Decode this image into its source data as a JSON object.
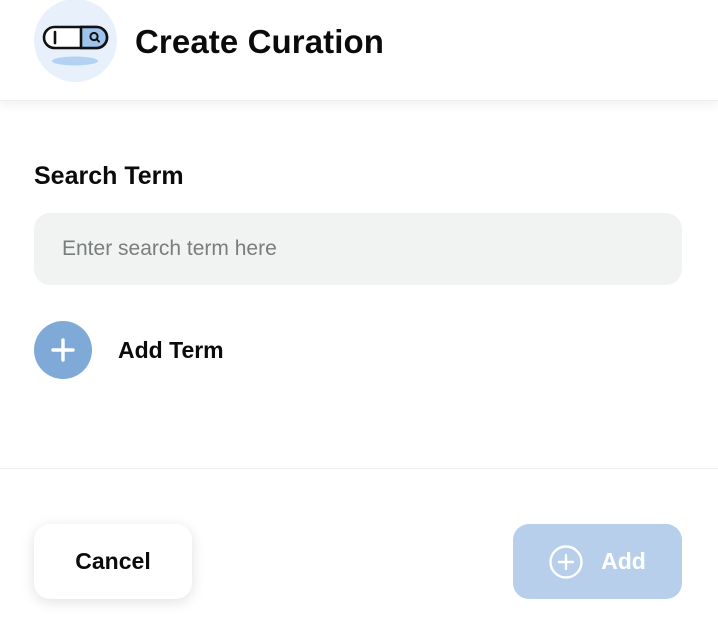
{
  "header": {
    "icon": "search-toggle-icon",
    "title": "Create Curation"
  },
  "form": {
    "search_label": "Search Term",
    "search_placeholder": "Enter search term here",
    "search_value": "",
    "add_term_icon": "plus-icon",
    "add_term_label": "Add Term"
  },
  "footer": {
    "cancel_label": "Cancel",
    "add_icon": "plus-circle-icon",
    "add_label": "Add"
  },
  "colors": {
    "header_icon_bg": "#e8f1fb",
    "add_term_circle": "#7faad8",
    "add_button_bg": "#b7cfea",
    "input_bg": "#f1f3f3"
  }
}
